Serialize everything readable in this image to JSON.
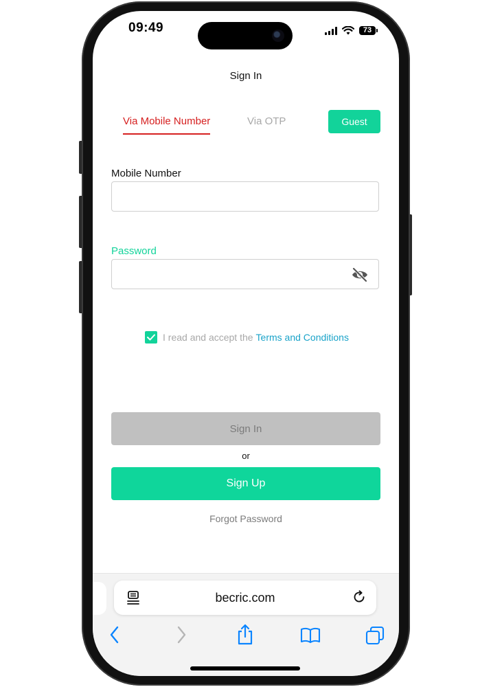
{
  "status_bar": {
    "time": "09:49",
    "battery": "73"
  },
  "page": {
    "title": "Sign In",
    "tabs": {
      "mobile": "Via Mobile Number",
      "otp": "Via OTP"
    },
    "guest_button": "Guest",
    "mobile_label": "Mobile Number",
    "mobile_value": "",
    "password_label": "Password",
    "password_value": "",
    "terms_prefix": "I read and accept the",
    "terms_link": "Terms and Conditions",
    "terms_checked": true,
    "signin_button": "Sign In",
    "or_text": "or",
    "signup_button": "Sign Up",
    "forgot_password": "Forgot Password"
  },
  "browser": {
    "url": "becric.com"
  },
  "colors": {
    "accent_green": "#12d39a",
    "active_tab_red": "#d62020",
    "link_blue": "#1aa3c9",
    "disabled_gray": "#c0c0c0",
    "ios_blue": "#0a84ff"
  },
  "icons": {
    "password_toggle": "eye-off-icon",
    "checkbox": "checkmark-icon",
    "reader": "reader-icon",
    "reload": "reload-icon",
    "back": "chevron-left-icon",
    "forward": "chevron-right-icon",
    "share": "share-icon",
    "bookmarks": "book-icon",
    "tabs": "tabs-icon"
  }
}
